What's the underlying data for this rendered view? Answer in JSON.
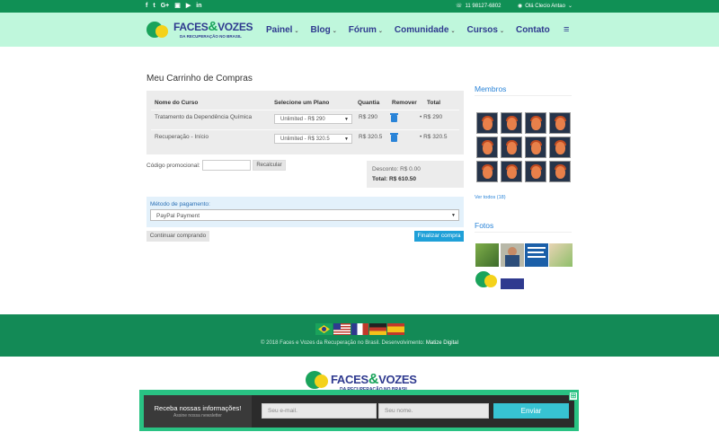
{
  "topbar": {
    "social_icons": [
      "facebook-icon",
      "twitter-icon",
      "google-plus-icon",
      "instagram-icon",
      "youtube-icon",
      "linkedin-icon"
    ],
    "social_glyphs": [
      "f",
      "t",
      "G+",
      "▣",
      "▶",
      "in"
    ],
    "phone": "11 98127-6802",
    "user_greeting": "Olá Clecio Antao"
  },
  "header": {
    "logo_name_a": "FACES",
    "logo_amp": "&",
    "logo_name_b": "VOZES",
    "logo_tagline": "DA RECUPERAÇÃO NO BRASIL",
    "nav": [
      "Painel",
      "Blog",
      "Fórum",
      "Comunidade",
      "Cursos",
      "Contato"
    ],
    "menu_glyph": "≡"
  },
  "cart": {
    "title": "Meu Carrinho de Compras",
    "headers": {
      "course": "Nome do Curso",
      "plan": "Selecione um Plano",
      "qty": "Quantia",
      "remove": "Remover",
      "total": "Total"
    },
    "rows": [
      {
        "course": "Tratamento da Dependência Química",
        "plan": "Unlimited - R$ 290",
        "qty": "R$ 290",
        "total": "R$ 290"
      },
      {
        "course": "Recuperação - Início",
        "plan": "Unlimited - R$ 320.5",
        "qty": "R$ 320.5",
        "total": "R$ 320.5"
      }
    ],
    "promo_label": "Código promocional:",
    "recalc_label": "Recalcular",
    "discount": "Desconto: R$ 0.00",
    "total": "Total: R$ 610.50",
    "payment_label": "Método de pagamento:",
    "payment_value": "PayPal Payment",
    "continue_label": "Continuar comprando",
    "finish_label": "Finalizar compra"
  },
  "sidebar": {
    "members_title": "Membros",
    "view_all": "Ver todos (18)",
    "photos_title": "Fotos"
  },
  "footer": {
    "flags": [
      "Brasil",
      "USA",
      "France",
      "Germany",
      "Spain"
    ],
    "copyright": "© 2018 Faces e Vozes da Recuperação no Brasil. Desenvolvimento:",
    "developer": "Matize Digital"
  },
  "newsletter": {
    "title": "Receba nossas informações!",
    "subtitle": "Assine nossa newsletter",
    "email_placeholder": "Seu e-mail.",
    "name_placeholder": "Seu nome.",
    "button": "Enviar",
    "expand_glyph": "⊞"
  },
  "colors": {
    "topbar": "#109055",
    "header_bg": "#bff7dc",
    "nav_text": "#2f3a8f",
    "accent_blue": "#2a84d8",
    "finish_button": "#1fa0d8",
    "footer": "#138a56",
    "newsletter": "#29c283"
  }
}
